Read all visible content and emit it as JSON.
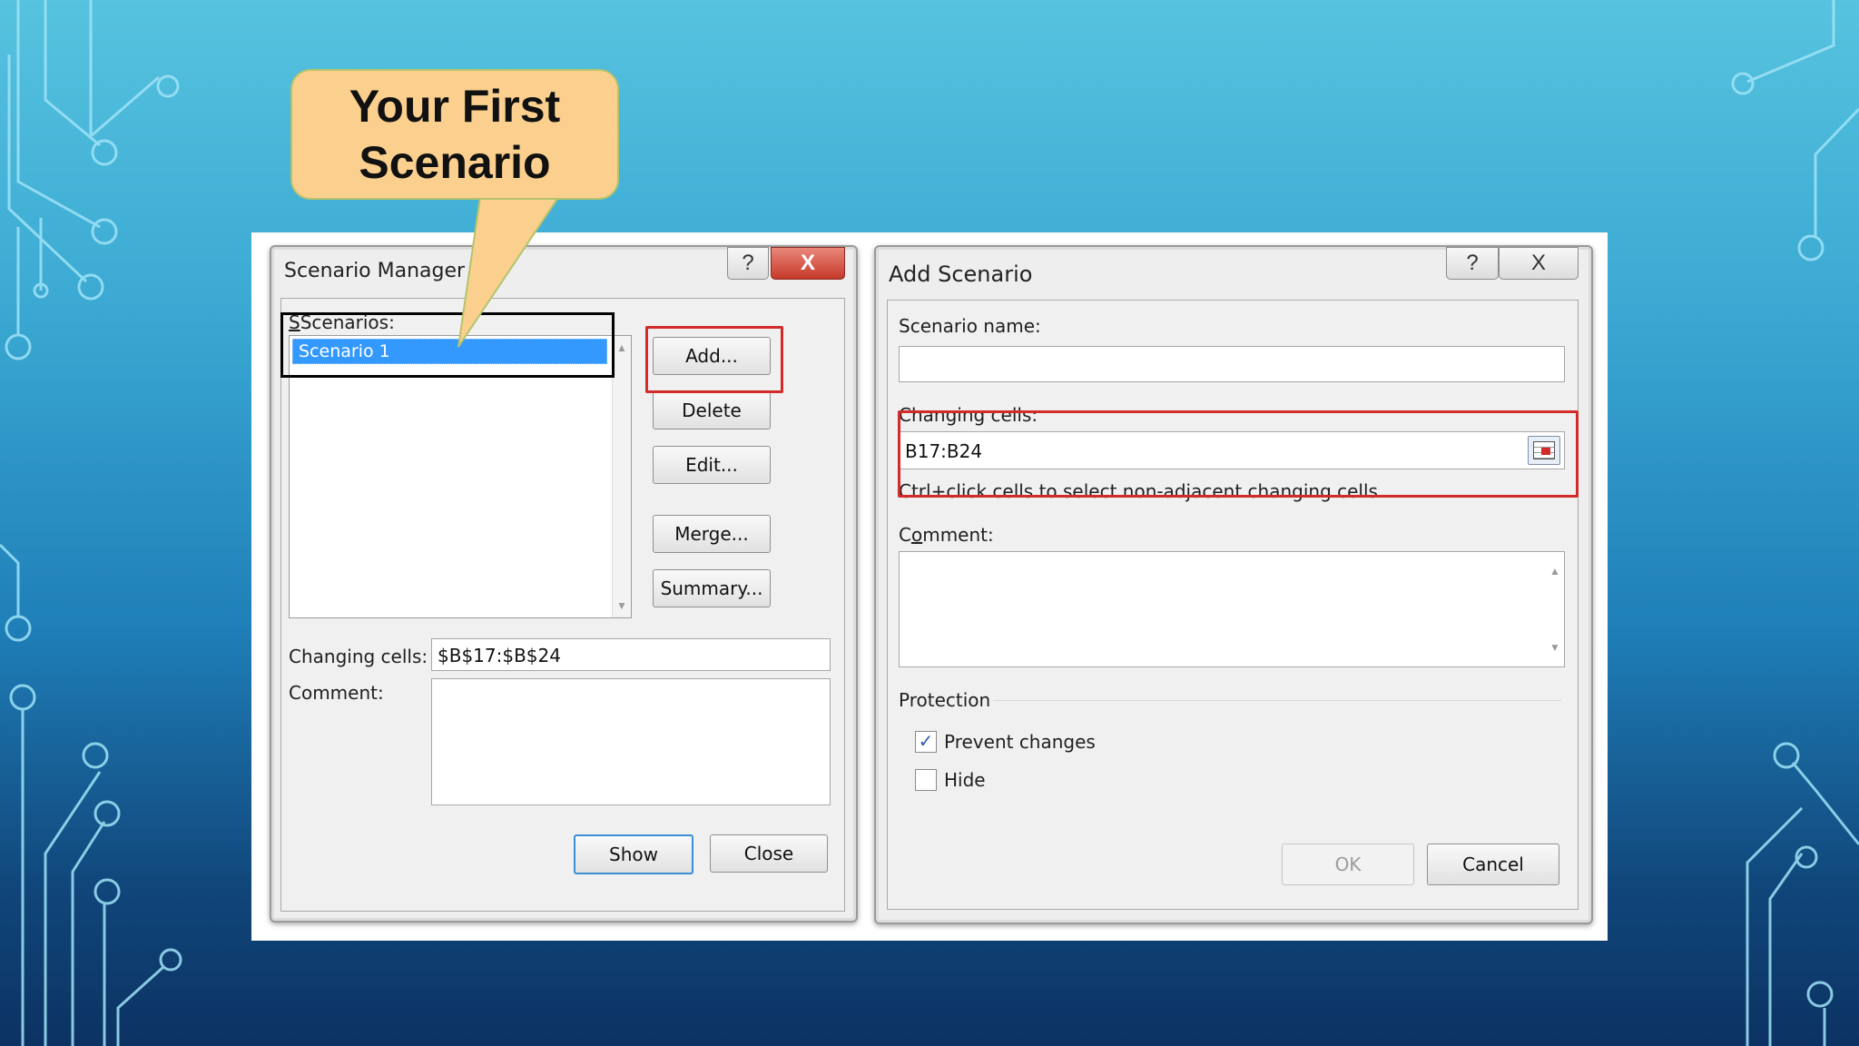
{
  "callout": {
    "line1": "Your First",
    "line2": "Scenario"
  },
  "scenario_manager": {
    "title": "Scenario Manager",
    "help": "?",
    "close_x": "X",
    "scenarios_label": "Scenarios:",
    "scenarios": [
      "Scenario 1"
    ],
    "buttons": {
      "add": "Add...",
      "delete": "Delete",
      "edit": "Edit...",
      "merge": "Merge...",
      "summary": "Summary..."
    },
    "changing_cells_label": "Changing cells:",
    "changing_cells_value": "$B$17:$B$24",
    "comment_label": "Comment:",
    "show": "Show",
    "close": "Close"
  },
  "add_scenario": {
    "title": "Add Scenario",
    "help": "?",
    "close_x": "X",
    "scenario_name_label": "Scenario name:",
    "scenario_name_value": "",
    "changing_cells_label": "Changing cells:",
    "changing_cells_value": "B17:B24",
    "hint": "Ctrl+click cells to select non-adjacent changing cells.",
    "comment_label": "Comment:",
    "protection_label": "Protection",
    "prevent_changes": {
      "label": "Prevent changes",
      "checked": true
    },
    "hide": {
      "label": "Hide",
      "checked": false
    },
    "ok": "OK",
    "cancel": "Cancel"
  },
  "colors": {
    "highlight": "#d32a2a",
    "selection": "#3399ff",
    "callout": "#fbd08e"
  }
}
